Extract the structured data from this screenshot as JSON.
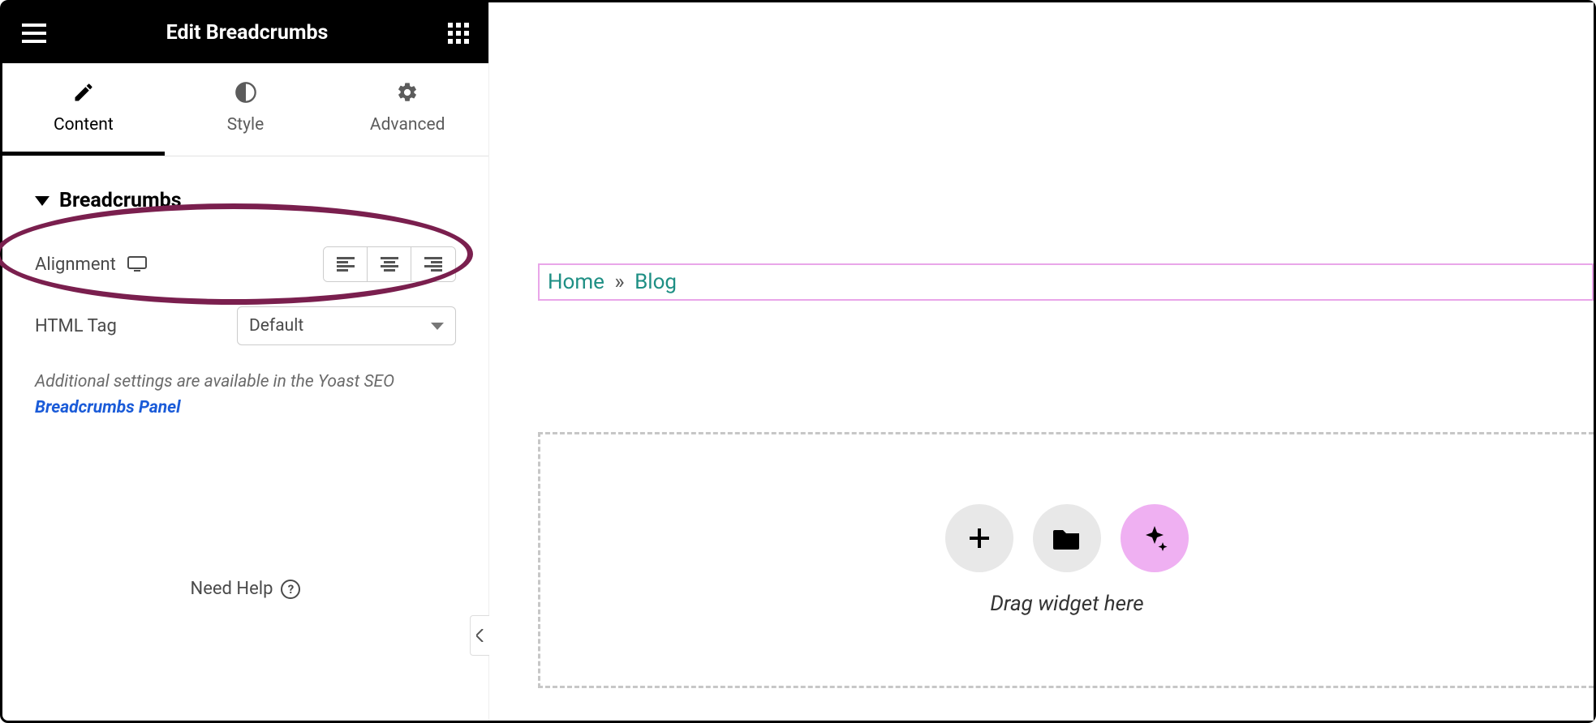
{
  "header": {
    "title": "Edit Breadcrumbs"
  },
  "tabs": {
    "content": "Content",
    "style": "Style",
    "advanced": "Advanced",
    "active": "content"
  },
  "section": {
    "title": "Breadcrumbs"
  },
  "controls": {
    "alignment_label": "Alignment",
    "html_tag_label": "HTML Tag",
    "html_tag_value": "Default"
  },
  "note": {
    "prefix": "Additional settings are available in the Yoast SEO ",
    "link": "Breadcrumbs Panel"
  },
  "help": {
    "label": "Need Help"
  },
  "canvas": {
    "breadcrumb_home": "Home",
    "breadcrumb_sep": "»",
    "breadcrumb_page": "Blog",
    "drop_label": "Drag widget here"
  }
}
